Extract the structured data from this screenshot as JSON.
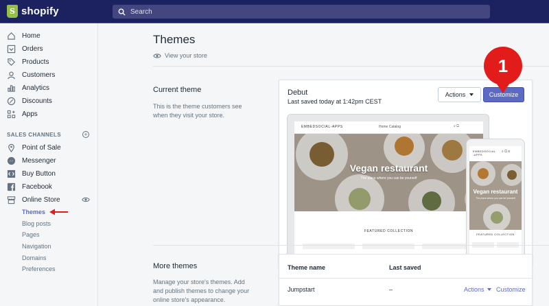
{
  "brand": {
    "name": "shopify"
  },
  "search": {
    "placeholder": "Search"
  },
  "sidebar": {
    "items": [
      {
        "label": "Home",
        "icon": "home-icon"
      },
      {
        "label": "Orders",
        "icon": "orders-icon"
      },
      {
        "label": "Products",
        "icon": "tag-icon"
      },
      {
        "label": "Customers",
        "icon": "person-icon"
      },
      {
        "label": "Analytics",
        "icon": "bar-chart-icon"
      },
      {
        "label": "Discounts",
        "icon": "discount-icon"
      },
      {
        "label": "Apps",
        "icon": "apps-icon"
      }
    ],
    "sales_channels_title": "SALES CHANNELS",
    "channels": [
      {
        "label": "Point of Sale",
        "icon": "location-pin-icon"
      },
      {
        "label": "Messenger",
        "icon": "messenger-icon"
      },
      {
        "label": "Buy Button",
        "icon": "code-icon"
      },
      {
        "label": "Facebook",
        "icon": "facebook-icon"
      },
      {
        "label": "Online Store",
        "icon": "store-icon"
      }
    ],
    "online_store_subitems": [
      {
        "label": "Themes",
        "active": true
      },
      {
        "label": "Blog posts"
      },
      {
        "label": "Pages"
      },
      {
        "label": "Navigation"
      },
      {
        "label": "Domains"
      },
      {
        "label": "Preferences"
      }
    ]
  },
  "main": {
    "title": "Themes",
    "view_store": "View your store",
    "current_theme": {
      "heading": "Current theme",
      "description": "This is the theme customers see when they visit your store.",
      "theme_name": "Debut",
      "last_saved": "Last saved today at 1:42pm CEST",
      "actions_label": "Actions",
      "customize_label": "Customize"
    },
    "annotation_badge": "1",
    "preview": {
      "store_brand": "EMBEDSOCIAL-APPS",
      "nav_links": "Home    Catalog",
      "hero_title": "Vegan restaurant",
      "hero_subtitle": "The place where you can be yourself",
      "featured": "FEATURED COLLECTION",
      "phone_brand": "EMBEDSOCIAL -APPS",
      "phone_hero_title": "Vegan restaurant",
      "phone_hero_subtitle": "The place where you can be yourself",
      "phone_featured": "FEATURED COLLECTION"
    },
    "more_themes": {
      "heading": "More themes",
      "description": "Manage your store's themes. Add and publish themes to change your online store's appearance.",
      "col_name": "Theme name",
      "col_saved": "Last saved",
      "rows": [
        {
          "name": "Jumpstart",
          "last_saved": "–",
          "actions_label": "Actions",
          "customize_label": "Customize"
        }
      ]
    }
  },
  "colors": {
    "topbar": "#1c2260",
    "accent": "#5c6ac4",
    "badge": "#e21b1b",
    "brand_green": "#95bf47"
  }
}
